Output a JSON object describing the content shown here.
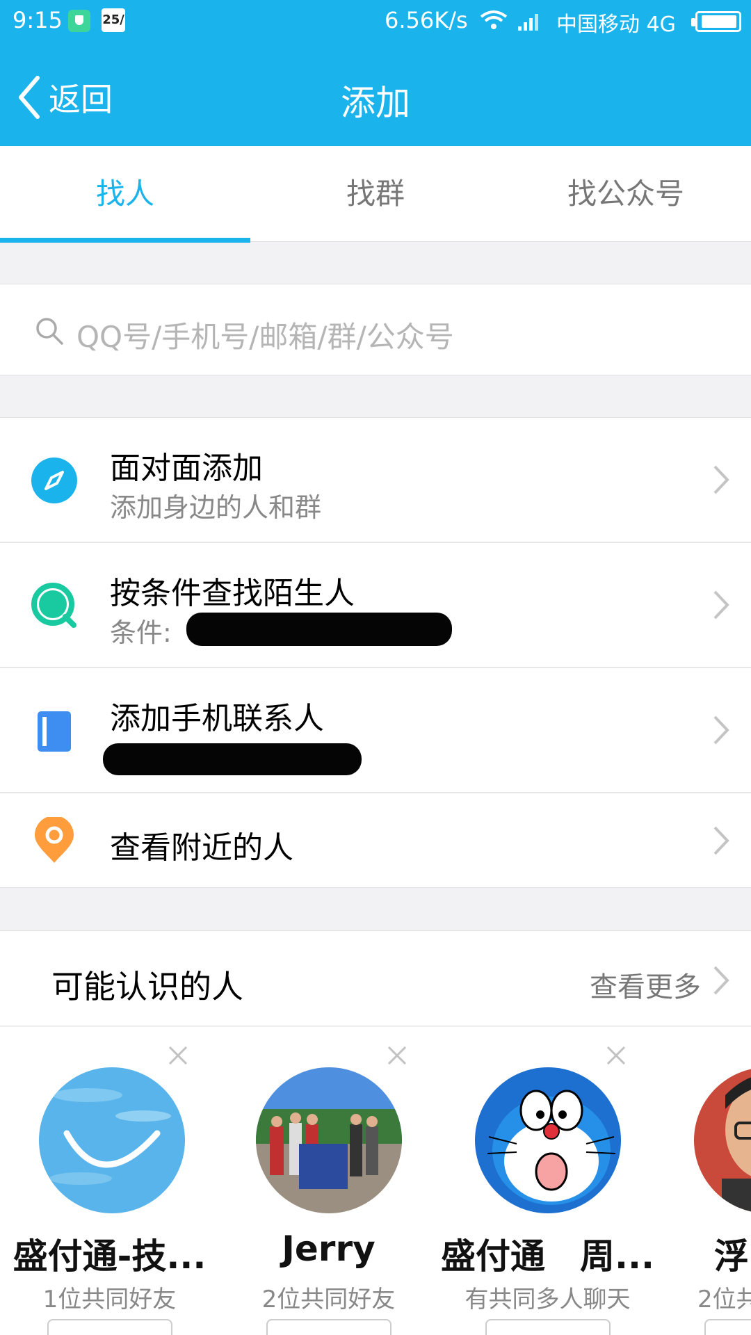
{
  "status_bar": {
    "time": "9:15",
    "calendar_day": "25/",
    "network_speed": "6.56K/s",
    "carrier": "中国移动 4G"
  },
  "nav": {
    "back_label": "返回",
    "title": "添加"
  },
  "tabs": [
    {
      "label": "找人",
      "active": true
    },
    {
      "label": "找群",
      "active": false
    },
    {
      "label": "找公众号",
      "active": false
    }
  ],
  "search": {
    "placeholder": "QQ号/手机号/邮箱/群/公众号"
  },
  "menu": [
    {
      "title": "面对面添加",
      "subtitle": "添加身边的人和群",
      "icon": "compass-icon",
      "color": "#1ab3ec"
    },
    {
      "title": "按条件查找陌生人",
      "subtitle": "条件:",
      "icon": "search-circle-icon",
      "color": "#19c9a0"
    },
    {
      "title": "添加手机联系人",
      "subtitle": "",
      "icon": "contacts-book-icon",
      "color": "#3d8ef0"
    },
    {
      "title": "查看附近的人",
      "icon": "location-pin-icon",
      "color": "#ff9c3c"
    }
  ],
  "people_section": {
    "title": "可能认识的人",
    "more_label": "查看更多"
  },
  "people": [
    {
      "name": "盛付通-技...",
      "mutual": "1位共同好友"
    },
    {
      "name": "Jerry",
      "mutual": "2位共同好友"
    },
    {
      "name": "盛付通　周...",
      "mutual": "有共同多人聊天"
    },
    {
      "name": "浮",
      "mutual": "2位共"
    }
  ],
  "colors": {
    "brand": "#1ab3ec",
    "secondary_text": "#888888",
    "divider": "#e0e0e0"
  }
}
